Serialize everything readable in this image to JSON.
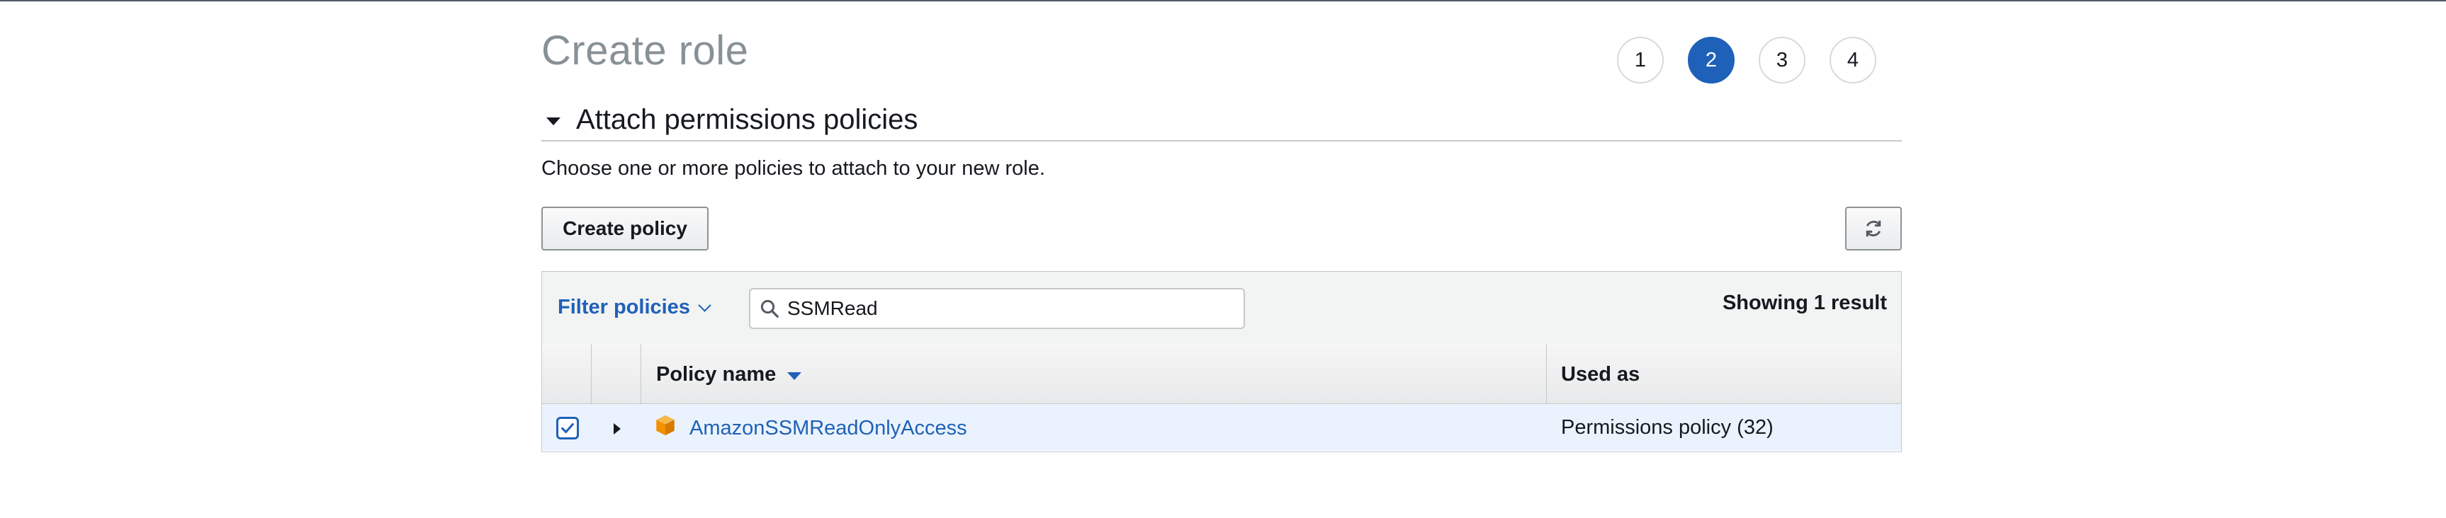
{
  "page": {
    "title": "Create role"
  },
  "steps": [
    "1",
    "2",
    "3",
    "4"
  ],
  "active_step": "2",
  "section": {
    "title": "Attach permissions policies",
    "description": "Choose one or more policies to attach to your new role."
  },
  "toolbar": {
    "create_policy_label": "Create policy",
    "refresh_icon": "refresh-icon"
  },
  "filter": {
    "label": "Filter policies",
    "search_value": "SSMRead",
    "result_count": "Showing 1 result"
  },
  "table": {
    "columns": [
      "Policy name",
      "Used as"
    ],
    "rows": [
      {
        "checked": true,
        "policy_name": "AmazonSSMReadOnlyAccess",
        "used_as": "Permissions policy (32)"
      }
    ]
  },
  "colors": {
    "accent": "#1f61b8",
    "selected_row": "#eaf3fd",
    "policy_icon": "#f29100"
  }
}
